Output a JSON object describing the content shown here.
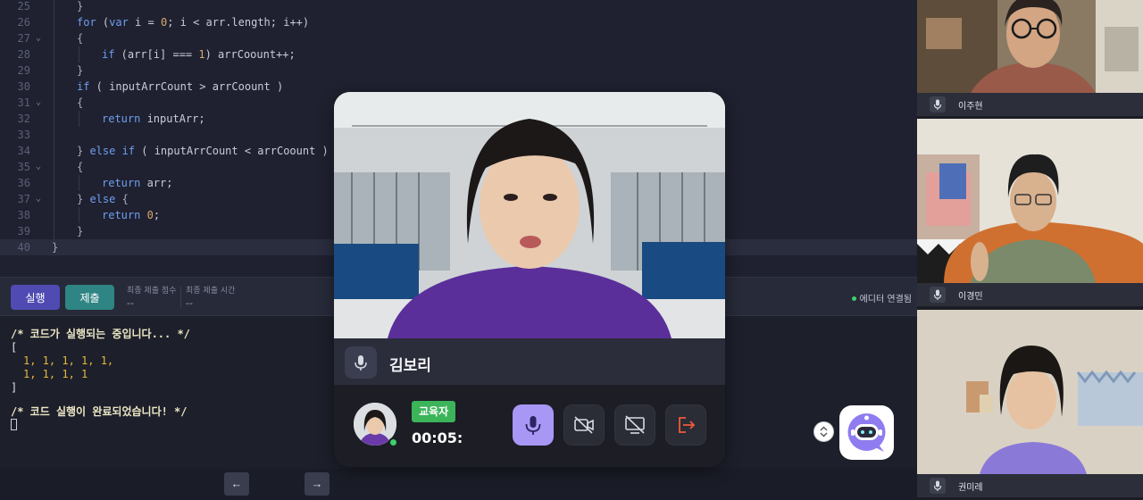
{
  "editor": {
    "lines": [
      {
        "num": "25",
        "fold": false,
        "indent": 1,
        "tokens": [
          [
            "o",
            "}"
          ]
        ]
      },
      {
        "num": "26",
        "fold": false,
        "indent": 1,
        "tokens": [
          [
            "k",
            "for"
          ],
          [
            "v",
            " ("
          ],
          [
            "k",
            "var"
          ],
          [
            "v",
            " i = "
          ],
          [
            "n",
            "0"
          ],
          [
            "v",
            "; i < arr.length; i++)"
          ]
        ]
      },
      {
        "num": "27",
        "fold": true,
        "indent": 1,
        "tokens": [
          [
            "o",
            "{"
          ]
        ]
      },
      {
        "num": "28",
        "fold": false,
        "indent": 2,
        "tokens": [
          [
            "k",
            "if"
          ],
          [
            "v",
            " (arr[i] === "
          ],
          [
            "n",
            "1"
          ],
          [
            "v",
            ") arrCoount++;"
          ]
        ]
      },
      {
        "num": "29",
        "fold": false,
        "indent": 1,
        "tokens": [
          [
            "o",
            "}"
          ]
        ]
      },
      {
        "num": "30",
        "fold": false,
        "indent": 1,
        "tokens": [
          [
            "k",
            "if"
          ],
          [
            "v",
            " ( inputArrCount > arrCoount )"
          ]
        ]
      },
      {
        "num": "31",
        "fold": true,
        "indent": 1,
        "tokens": [
          [
            "o",
            "{"
          ]
        ]
      },
      {
        "num": "32",
        "fold": false,
        "indent": 2,
        "tokens": [
          [
            "k",
            "return"
          ],
          [
            "v",
            " inputArr;"
          ]
        ]
      },
      {
        "num": "33",
        "fold": false,
        "indent": 1,
        "tokens": []
      },
      {
        "num": "34",
        "fold": false,
        "indent": 1,
        "tokens": [
          [
            "o",
            "} "
          ],
          [
            "k",
            "else if"
          ],
          [
            "v",
            " ( inputArrCount < arrCoount )"
          ]
        ]
      },
      {
        "num": "35",
        "fold": true,
        "indent": 1,
        "tokens": [
          [
            "o",
            "{"
          ]
        ]
      },
      {
        "num": "36",
        "fold": false,
        "indent": 2,
        "tokens": [
          [
            "k",
            "return"
          ],
          [
            "v",
            " arr;"
          ]
        ]
      },
      {
        "num": "37",
        "fold": true,
        "indent": 1,
        "tokens": [
          [
            "o",
            "} "
          ],
          [
            "k",
            "else"
          ],
          [
            "o",
            " {"
          ]
        ]
      },
      {
        "num": "38",
        "fold": false,
        "indent": 2,
        "tokens": [
          [
            "k",
            "return"
          ],
          [
            "v",
            " "
          ],
          [
            "n",
            "0"
          ],
          [
            "v",
            ";"
          ]
        ]
      },
      {
        "num": "39",
        "fold": false,
        "indent": 1,
        "tokens": [
          [
            "o",
            "}"
          ]
        ]
      },
      {
        "num": "40",
        "fold": false,
        "indent": 0,
        "tokens": [
          [
            "o",
            "}"
          ]
        ],
        "active": true
      }
    ]
  },
  "toolbar": {
    "run_label": "실행",
    "submit_label": "제출",
    "last_score_label": "최종 제출 점수",
    "last_score_value": "--",
    "last_time_label": "최종 제출 시간",
    "last_time_value": "--",
    "connection_status": "에디터 연결됨"
  },
  "console": {
    "line1": "/* 코드가 실행되는 중입니다... */",
    "open_bracket": "[",
    "row1": "1, 1, 1, 1, 1,",
    "row2": "1, 1, 1, 1",
    "close_bracket": "]",
    "line_done": "/* 코드 실행이 완료되었습니다! */"
  },
  "nav": {
    "prev_icon": "←",
    "next_icon": "→"
  },
  "participants": [
    {
      "name": "이주현",
      "mic_icon": "mic-icon"
    },
    {
      "name": "이경민",
      "mic_icon": "mic-icon"
    },
    {
      "name": "권미레",
      "mic_icon": "mic-icon"
    }
  ],
  "call": {
    "main_speaker": "김보리",
    "role": "교육자",
    "timer": "00:05:",
    "controls": [
      "mic-icon",
      "camera-off-icon",
      "screen-share-off-icon",
      "leave-icon"
    ]
  },
  "colors": {
    "accent": "#4f4bb3",
    "submit": "#2f8583",
    "mic_active": "#a997f5",
    "leave": "#f05a3a",
    "online": "#3fcf6b"
  }
}
